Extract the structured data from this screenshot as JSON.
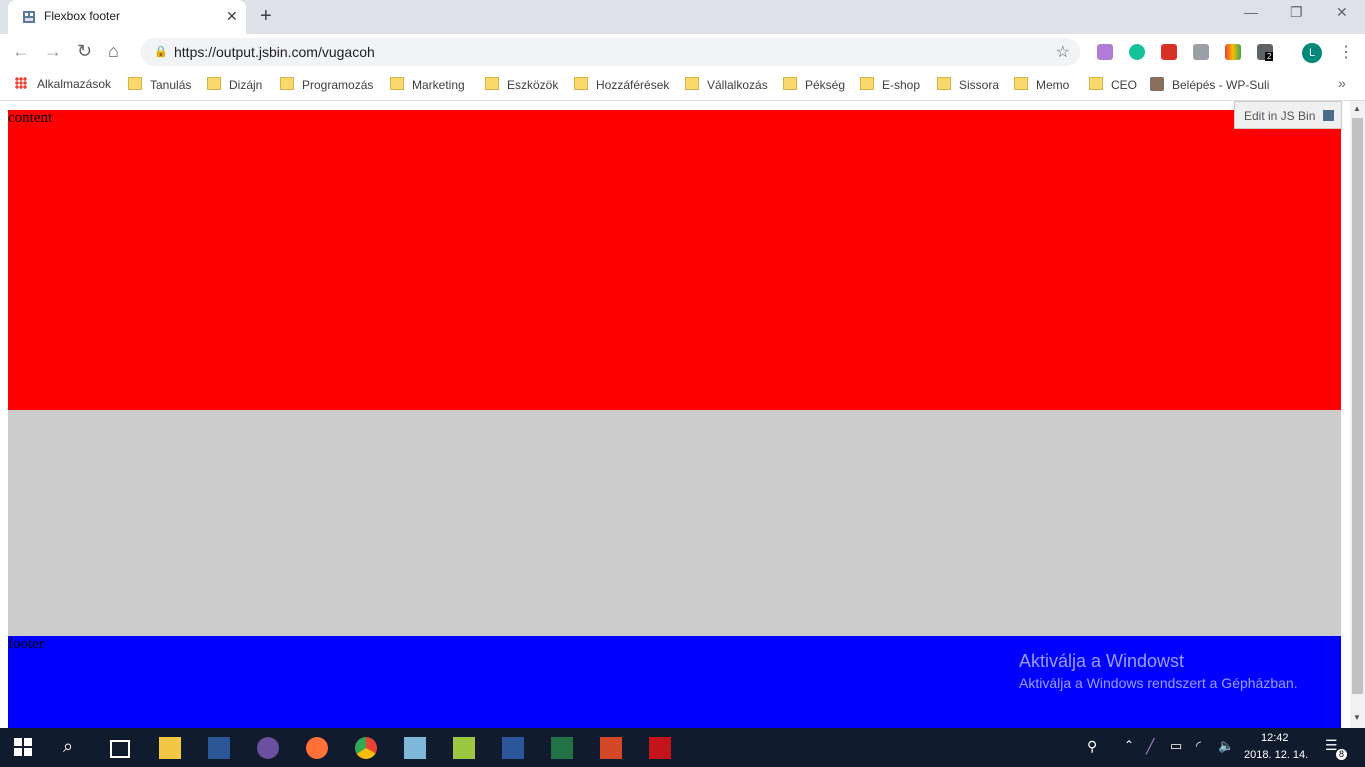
{
  "browser": {
    "tab_title": "Flexbox footer",
    "tab_close": "✕",
    "new_tab": "+",
    "url": "https://output.jsbin.com/vugacoh",
    "profile_initial": "L",
    "ext_badge": "2"
  },
  "bookmarks": [
    "Alkalmazások",
    "Tanulás",
    "Dizájn",
    "Programozás",
    "Marketing",
    "Eszközök",
    "Hozzáférések",
    "Vállalkozás",
    "Pékség",
    "E-shop",
    "Sissora",
    "Memo",
    "CEO",
    "Belépés - WP-Suli"
  ],
  "page": {
    "content_text": "content",
    "footer_text": "footer",
    "edit_label": "Edit in JS Bin",
    "colors": {
      "content": "#ff0000",
      "middle": "#cccccc",
      "footer": "#0000ff"
    }
  },
  "watermark": {
    "line1": "Aktiválja a Windowst",
    "line2": "Aktiválja a Windows rendszert a Gépházban."
  },
  "taskbar": {
    "time": "12:42",
    "date": "2018. 12. 14.",
    "notification_count": "8"
  }
}
